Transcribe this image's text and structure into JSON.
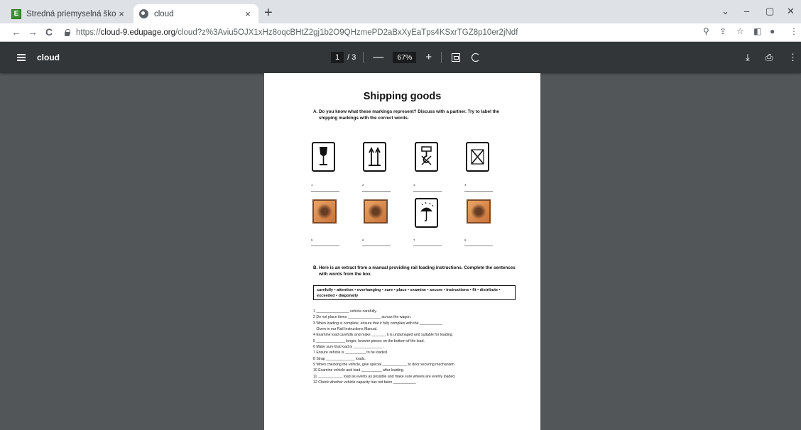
{
  "browser": {
    "tabs": [
      {
        "title": "Stredná priemyselná škola inform",
        "close": "×"
      },
      {
        "title": "cloud",
        "close": "×"
      }
    ],
    "new_tab": "+",
    "window_controls": {
      "minimize": "–",
      "maximize": "▢",
      "close": "✕",
      "menu": "⌄"
    },
    "nav": {
      "back": "←",
      "forward": "→",
      "reload": "C"
    },
    "url": {
      "scheme": "https://",
      "host": "cloud-9.edupage.org",
      "path": "/cloud?z%3Aviu5OJX1xHz8oqcBHtZ2gj1b2O9QHzmePD2aBxXyEaTps4KSxrTGZ8p10er2jNdf"
    }
  },
  "pdf_viewer": {
    "title": "cloud",
    "page_current": "1",
    "page_total": "/ 3",
    "zoom": "67%",
    "zoom_out": "—",
    "zoom_in": "+"
  },
  "document": {
    "title": "Shipping goods",
    "question_a": {
      "number": "A.",
      "text": "Do you know what these markings represent? Discuss with a partner. Try to label the shipping markings with the correct words."
    },
    "label_numbers": [
      "1",
      "2",
      "3",
      "4",
      "5",
      "6",
      "7",
      "8"
    ],
    "question_b": {
      "number": "B.",
      "text": "Here is an extract from a manual providing rail loading instructions. Complete the sentences with words from the box."
    },
    "word_box": "carefully • attention • overhanging • sure • place • examine • secure • instructions • fit • distribute • exceeded • diagonally",
    "sentences": [
      "1 ________________ vehicle carefully.",
      "2 Do not place items ________________ across the wagon.",
      "3 When loading is complete, ensure that it fully complies with the ___________",
      "   Given in our Rail Instructions Manual.",
      "4 Examine load carefully and make _______ it is undamaged and suitable for loading.",
      "5 ______________ longer, heavier pieces on the bottom of the load.",
      "6 Make sure that load is ______________ .",
      "7 Ensure vehicle is __________ to be loaded.",
      "8 Strap ______________ loads.",
      "9 When checking the vehicle, give special ____________ to door securing mechanism.",
      "10 Examine vehicle and load __________ after loading.",
      "11 ____________ load as evenly as possible and make sure wheels are evenly loaded.",
      "12 Check whether vehicle capacity has not been ___________ ."
    ]
  }
}
